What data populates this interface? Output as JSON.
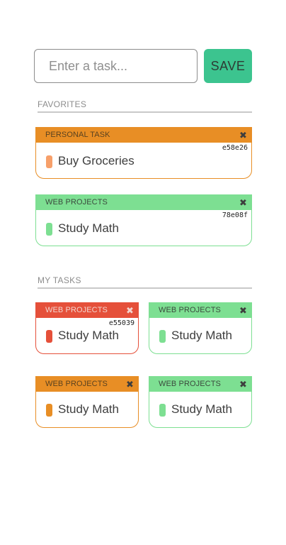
{
  "input": {
    "placeholder": "Enter a task...",
    "value": ""
  },
  "save_label": "SAVE",
  "sections": {
    "favorites_label": "FAVORITES",
    "mytasks_label": "MY TASKS"
  },
  "close_glyph": "✖",
  "favorites": [
    {
      "category": "PERSONAL TASK",
      "id": "e58e26",
      "text": "Buy Groceries",
      "color": "#e88e25",
      "dot_color": "#f7a06a"
    },
    {
      "category": "WEB PROJECTS",
      "id": "78e08f",
      "text": "Study Math",
      "color": "#7ddf92",
      "dot_color": "#7ddf92"
    }
  ],
  "my_tasks": [
    {
      "category": "WEB PROJECTS",
      "id": "e55039",
      "text": "Study Math",
      "color": "#e5503a",
      "dot_color": "#e5503a"
    },
    {
      "category": "WEB PROJECTS",
      "id": "",
      "text": "Study Math",
      "color": "#7ddf92",
      "dot_color": "#7ddf92"
    },
    {
      "category": "WEB PROJECTS",
      "id": "",
      "text": "Study Math",
      "color": "#e88e25",
      "dot_color": "#e88e25"
    },
    {
      "category": "WEB PROJECTS",
      "id": "",
      "text": "Study Math",
      "color": "#7ddf92",
      "dot_color": "#7ddf92"
    }
  ],
  "colors": {
    "accent_save": "#3cc48f",
    "orange": "#e88e25",
    "green": "#7ddf92",
    "red": "#e5503a"
  },
  "icons": {
    "close": "close-icon"
  }
}
